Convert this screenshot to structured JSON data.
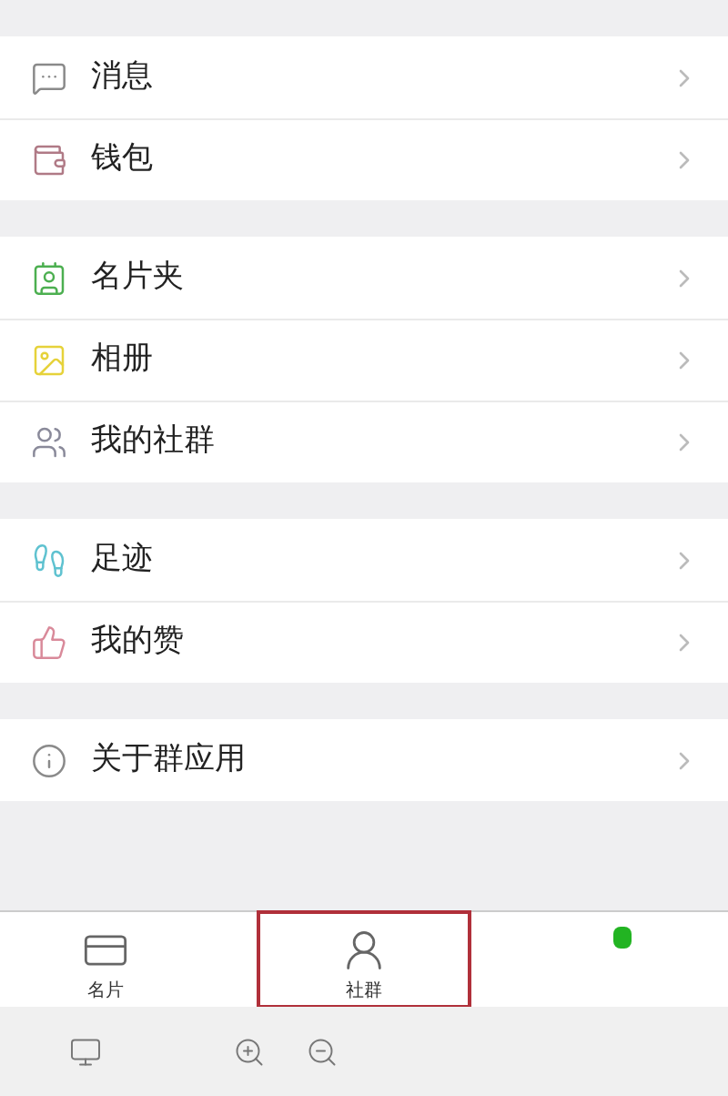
{
  "sections": [
    {
      "items": [
        {
          "label": "消息",
          "kind": "message",
          "color": "#8a8a8a"
        },
        {
          "label": "钱包",
          "kind": "wallet",
          "color": "#b07a86"
        }
      ]
    },
    {
      "items": [
        {
          "label": "名片夹",
          "kind": "contacts",
          "color": "#4caf50"
        },
        {
          "label": "相册",
          "kind": "album",
          "color": "#e6d23a"
        },
        {
          "label": "我的社群",
          "kind": "group",
          "color": "#8a8a9a"
        }
      ]
    },
    {
      "items": [
        {
          "label": "足迹",
          "kind": "footprint",
          "color": "#5fc2d0"
        },
        {
          "label": "我的赞",
          "kind": "like",
          "color": "#d98a9a"
        }
      ]
    },
    {
      "items": [
        {
          "label": "关于群应用",
          "kind": "info",
          "color": "#8a8a8a"
        }
      ]
    }
  ],
  "tab_bar": [
    {
      "label": "名片",
      "kind": "card",
      "highlighted": false
    },
    {
      "label": "社群",
      "kind": "person",
      "highlighted": true
    },
    {
      "kind": "app",
      "highlighted": false
    }
  ],
  "toolbar": [
    {
      "kind": "screen"
    },
    {
      "kind": "zoomin"
    },
    {
      "kind": "zoomout"
    }
  ]
}
